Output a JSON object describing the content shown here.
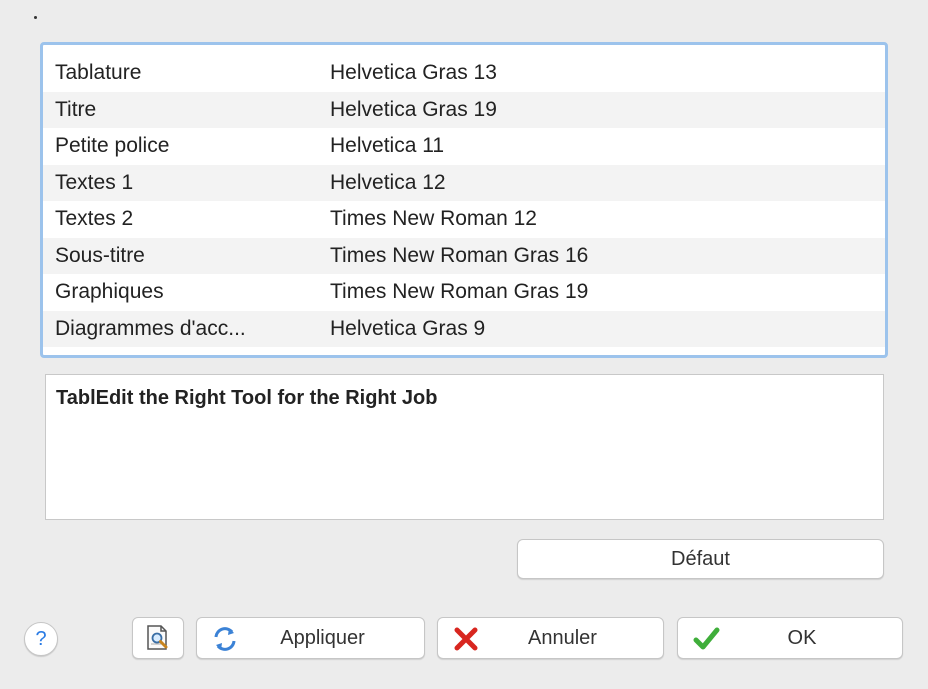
{
  "font_list": {
    "rows": [
      {
        "name": "Tablature",
        "font": "Helvetica Gras 13"
      },
      {
        "name": "Titre",
        "font": "Helvetica Gras 19"
      },
      {
        "name": "Petite police",
        "font": "Helvetica 11"
      },
      {
        "name": "Textes 1",
        "font": "Helvetica 12"
      },
      {
        "name": "Textes 2",
        "font": "Times New Roman 12"
      },
      {
        "name": "Sous-titre",
        "font": "Times New Roman Gras 16"
      },
      {
        "name": "Graphiques",
        "font": "Times New Roman Gras 19"
      },
      {
        "name": "Diagrammes d'acc...",
        "font": "Helvetica Gras 9"
      }
    ]
  },
  "preview": {
    "text": "TablEdit the Right Tool for the Right Job"
  },
  "buttons": {
    "default_label": "Défaut",
    "help_label": "?",
    "apply_label": "Appliquer",
    "cancel_label": "Annuler",
    "ok_label": "OK"
  },
  "icons": {
    "help": "help-icon",
    "preview": "print-preview-icon",
    "apply": "refresh-icon",
    "cancel": "red-x-icon",
    "ok": "green-check-icon"
  },
  "colors": {
    "list_focus_border": "#9cc3ec",
    "help_blue": "#2a7be4",
    "cancel_red": "#d8261f",
    "ok_green": "#3fae3a"
  }
}
